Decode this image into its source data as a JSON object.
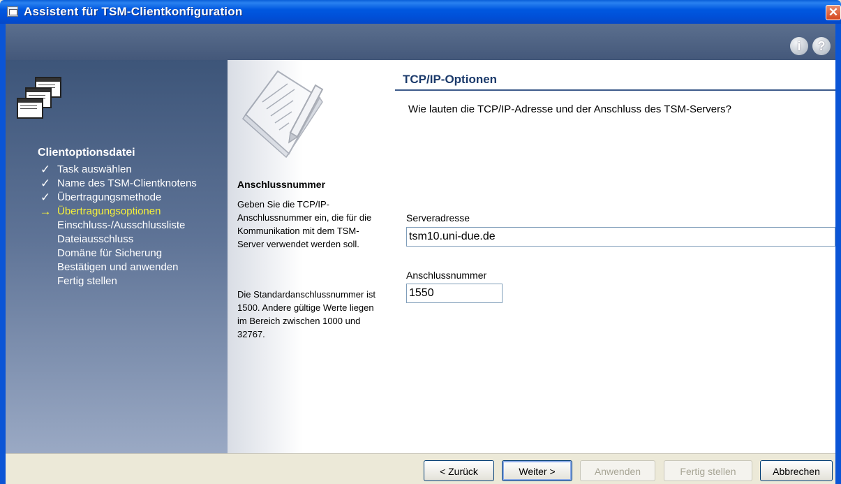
{
  "window": {
    "title": "Assistent für TSM-Clientkonfiguration",
    "close_glyph": "✕",
    "accent_color": "#0b55d6"
  },
  "header": {
    "info_glyph": "i",
    "help_glyph": "?"
  },
  "nav": {
    "heading": "Clientoptionsdatei",
    "items": [
      {
        "label": "Task auswählen",
        "status": "done",
        "mark": "✓"
      },
      {
        "label": "Name des TSM-Clientknotens",
        "status": "done",
        "mark": "✓"
      },
      {
        "label": "Übertragungsmethode",
        "status": "done",
        "mark": "✓"
      },
      {
        "label": "Übertragungsoptionen",
        "status": "current",
        "mark": "→"
      },
      {
        "label": "Einschluss-/Ausschlussliste",
        "status": "pending",
        "mark": ""
      },
      {
        "label": "Dateiausschluss",
        "status": "pending",
        "mark": ""
      },
      {
        "label": "Domäne für Sicherung",
        "status": "pending",
        "mark": ""
      },
      {
        "label": "Bestätigen und anwenden",
        "status": "pending",
        "mark": ""
      },
      {
        "label": "Fertig stellen",
        "status": "pending",
        "mark": ""
      }
    ],
    "current_color": "#f5f03a"
  },
  "info": {
    "title": "Anschlussnummer",
    "paragraph1": "Geben Sie die TCP/IP-Anschlussnummer ein, die für die Kommunikation mit dem TSM-Server verwendet werden soll.",
    "paragraph2": "Die Standardanschlussnummer ist 1500. Andere gültige Werte liegen im Bereich zwischen 1000 und 32767."
  },
  "main": {
    "title": "TCP/IP-Optionen",
    "question": "Wie lauten die TCP/IP-Adresse und der Anschluss des TSM-Servers?",
    "server_label": "Serveradresse",
    "server_value": "tsm10.uni-due.de",
    "port_label": "Anschlussnummer",
    "port_value": "1550"
  },
  "buttons": {
    "back": "< Zurück",
    "next": "Weiter >",
    "apply": "Anwenden",
    "finish": "Fertig stellen",
    "cancel": "Abbrechen"
  }
}
